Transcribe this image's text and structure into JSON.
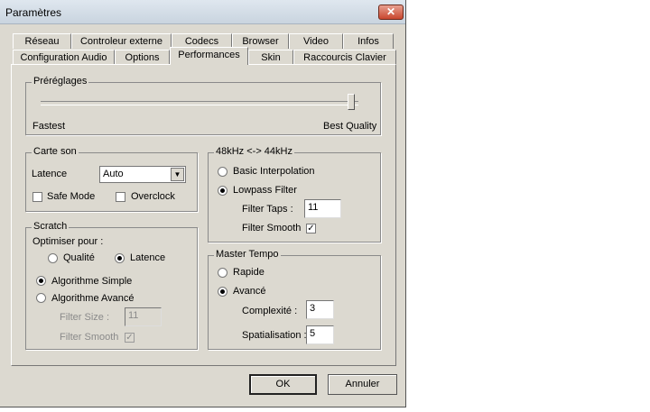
{
  "window": {
    "title": "Paramètres",
    "close_label": "✕"
  },
  "tabs_row1": [
    "Réseau",
    "Controleur externe",
    "Codecs",
    "Browser",
    "Video",
    "Infos"
  ],
  "tabs_row2": [
    "Configuration Audio",
    "Options",
    "Performances",
    "Skin",
    "Raccourcis Clavier"
  ],
  "active_tab": "Performances",
  "presets": {
    "title": "Préréglages",
    "min_label": "Fastest",
    "max_label": "Best Quality",
    "slider_value": 1.0
  },
  "sound_card": {
    "title": "Carte son",
    "latency_label": "Latence",
    "latency_value": "Auto",
    "safe_mode_label": "Safe Mode",
    "safe_mode_checked": false,
    "overclock_label": "Overclock",
    "overclock_checked": false
  },
  "resample": {
    "title": "48kHz <-> 44kHz",
    "basic_label": "Basic Interpolation",
    "lowpass_label": "Lowpass Filter",
    "selected": "lowpass",
    "filter_taps_label": "Filter Taps :",
    "filter_taps_value": "11",
    "filter_smooth_label": "Filter Smooth",
    "filter_smooth_checked": true
  },
  "scratch": {
    "title": "Scratch",
    "optimise_label": "Optimiser pour :",
    "quality_label": "Qualité",
    "latency_label": "Latence",
    "optimise_selected": "latency",
    "simple_label": "Algorithme Simple",
    "advanced_label": "Algorithme Avancé",
    "algorithm_selected": "simple",
    "filter_size_label": "Filter Size :",
    "filter_size_value": "11",
    "filter_smooth_label": "Filter Smooth",
    "filter_smooth_checked": true
  },
  "master_tempo": {
    "title": "Master Tempo",
    "fast_label": "Rapide",
    "advanced_label": "Avancé",
    "selected": "advanced",
    "complexity_label": "Complexité :",
    "complexity_value": "3",
    "spatial_label": "Spatialisation :",
    "spatial_value": "5"
  },
  "buttons": {
    "ok": "OK",
    "cancel": "Annuler"
  }
}
